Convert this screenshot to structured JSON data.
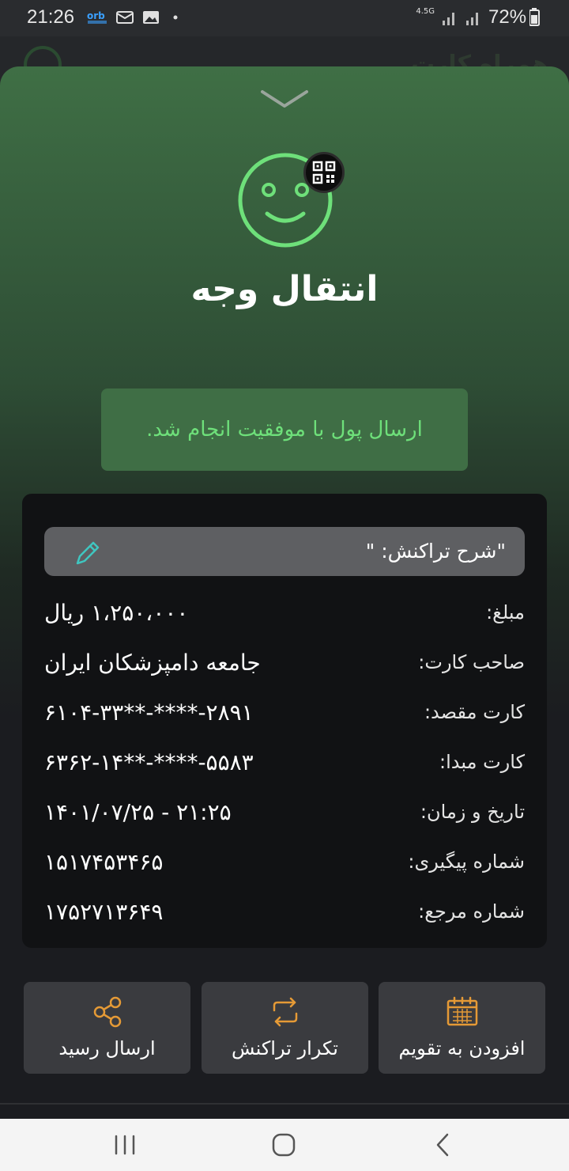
{
  "status": {
    "time": "21:26",
    "network": "4.5G",
    "battery": "72%",
    "notif_icons": [
      "orb-icon",
      "mail-icon",
      "image-icon",
      "dot-icon"
    ]
  },
  "background": {
    "title": "همراه کارت"
  },
  "sheet": {
    "title": "انتقال وجه",
    "success_message": "ارسال پول با موفقیت انجام شد.",
    "description": "\"شرح تراکنش: \"",
    "rows": [
      {
        "label": "مبلغ:",
        "value": "۱،۲۵۰،۰۰۰ ریال"
      },
      {
        "label": "صاحب کارت:",
        "value": "جامعه دامپزشکان ایران"
      },
      {
        "label": "کارت مقصد:",
        "value": "۶۱۰۴-۳۳**-****-۲۸۹۱"
      },
      {
        "label": "کارت مبدا:",
        "value": "۶۳۶۲-۱۴**-****-۵۵۸۳"
      },
      {
        "label": "تاریخ و زمان:",
        "value": "۱۴۰۱/۰۷/۲۵ - ۲۱:۲۵"
      },
      {
        "label": "شماره پیگیری:",
        "value": "۱۵۱۷۴۵۳۴۶۵"
      },
      {
        "label": "شماره مرجع:",
        "value": "۱۷۵۲۷۱۳۶۴۹"
      }
    ],
    "actions": {
      "share": "ارسال رسید",
      "repeat": "تکرار تراکنش",
      "calendar": "افزودن به تقویم"
    }
  },
  "colors": {
    "accent_green": "#6ee07a",
    "success_bg": "#3f6e45",
    "icon_orange": "#e59a36",
    "pencil_teal": "#3fc6c0"
  }
}
